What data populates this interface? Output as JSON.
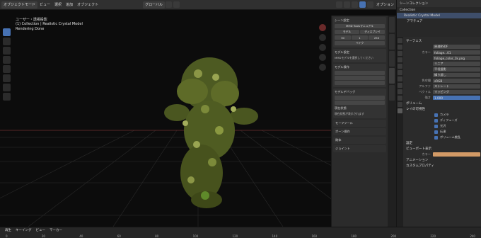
{
  "header": {
    "editor_label": "オブジェクトモード",
    "menus": [
      "ビュー",
      "選択",
      "追加",
      "オブジェクト"
    ],
    "orientation": "グローバル",
    "options_label": "オプション"
  },
  "viewport": {
    "view_name": "ユーザー・透視投影",
    "collection_line": "(1) Collection | Realistic Crystal Model",
    "status_line": "Rendering Done"
  },
  "npanel": {
    "scene_section": "シーン設定",
    "maid_btn": "MMD Toolsマニュアル",
    "model_label": "モデル",
    "display_label": "ディスプレイ",
    "fps_label": "30",
    "start_label": "1",
    "end_label": "250",
    "warning_text": "MMDモデルを選択してください",
    "model_section": "モデル設定",
    "model_ops_section": "モデル操作",
    "bake_label": "ベイク",
    "morph_section": "モデルデバッグ",
    "status_title": "現在状態",
    "status_text": "現在状態が表示されます",
    "closed_sections": [
      "モーフツール",
      "ボーン操作",
      "剛体",
      "ジョイント"
    ]
  },
  "outliner": {
    "header": "シーンコレクション",
    "rows": [
      "Collection",
      "Realistic Crystal Model",
      "アマチュア"
    ]
  },
  "properties": {
    "surface_section": "サーフェス",
    "surface_field": "原理BSDF",
    "color_label": "カラー",
    "color_value": "foliage...01",
    "image_file": "foliage_color_1k.png",
    "interp": "リニア",
    "projection": "平坦投影",
    "extension": "繰り返し",
    "color_space_label": "色空間",
    "color_space": "sRGB",
    "alpha_label": "アルファ",
    "alpha_value": "ストレート",
    "vector_label": "ベクトル",
    "vector_value": "マッピング",
    "strength_label": "強さ",
    "strength_value": "1.000",
    "volume_section": "ボリューム",
    "visibility_section": "レイの可視性",
    "checks": [
      "カメラ",
      "ディフューズ",
      "光沢",
      "伝達",
      "ボリューム散乱"
    ],
    "settings_section": "設定",
    "viewport_section": "ビューポート表示",
    "color_disp_label": "カラー",
    "animation_section": "アニメーション",
    "custom_section": "カスタムプロパティ"
  },
  "timeline": {
    "labels": [
      "再生",
      "キーイング",
      "ビュー",
      "マーカー"
    ],
    "ticks": [
      "0",
      "20",
      "40",
      "60",
      "80",
      "100",
      "120",
      "140",
      "160",
      "180",
      "200",
      "220",
      "240"
    ]
  }
}
